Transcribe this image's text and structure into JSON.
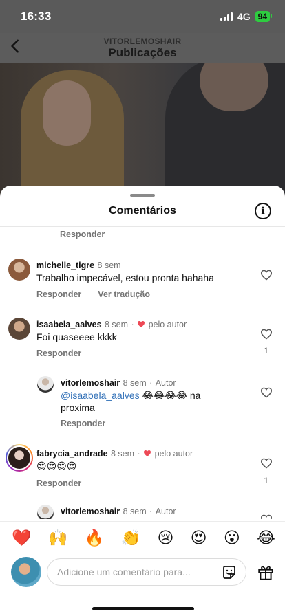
{
  "status_bar": {
    "time": "16:33",
    "network": "4G",
    "battery": "94"
  },
  "header": {
    "account": "VITORLEMOSHAIR",
    "title": "Publicações"
  },
  "sheet": {
    "title": "Comentários"
  },
  "comments": {
    "previous_reply_label": "Responder",
    "michelle": {
      "user": "michelle_tigre",
      "time": "8 sem",
      "text": "Trabalho impecável, estou pronta hahaha",
      "reply": "Responder",
      "translate": "Ver tradução"
    },
    "isabela": {
      "user": "isaabela_aalves",
      "time": "8 sem",
      "author_like": "pelo autor",
      "text": "Foi quaseeee kkkk",
      "reply": "Responder",
      "likes": "1"
    },
    "vitor_reply": {
      "user": "vitorlemoshair",
      "time": "8 sem",
      "badge": "Autor",
      "mention": "@isaabela_aalves",
      "text_emojis": "😂😂😂😂",
      "text_tail": "na",
      "text_line2": "proxima",
      "reply": "Responder"
    },
    "fabrycia": {
      "user": "fabrycia_andrade",
      "time": "8 sem",
      "author_like": "pelo autor",
      "text": "😍😍😍😍",
      "reply": "Responder",
      "likes": "1"
    },
    "vitor_partial": {
      "user": "vitorlemoshair",
      "time": "8 sem",
      "badge": "Autor"
    }
  },
  "emoji_bar": [
    "❤️",
    "🙌",
    "🔥",
    "👏",
    "😢",
    "😍",
    "😮",
    "😂"
  ],
  "composer": {
    "placeholder": "Adicione um comentário para..."
  },
  "colors": {
    "accent_red": "#ed4956",
    "mention_blue": "#2f6fb7",
    "battery_green": "#2ecc40"
  }
}
